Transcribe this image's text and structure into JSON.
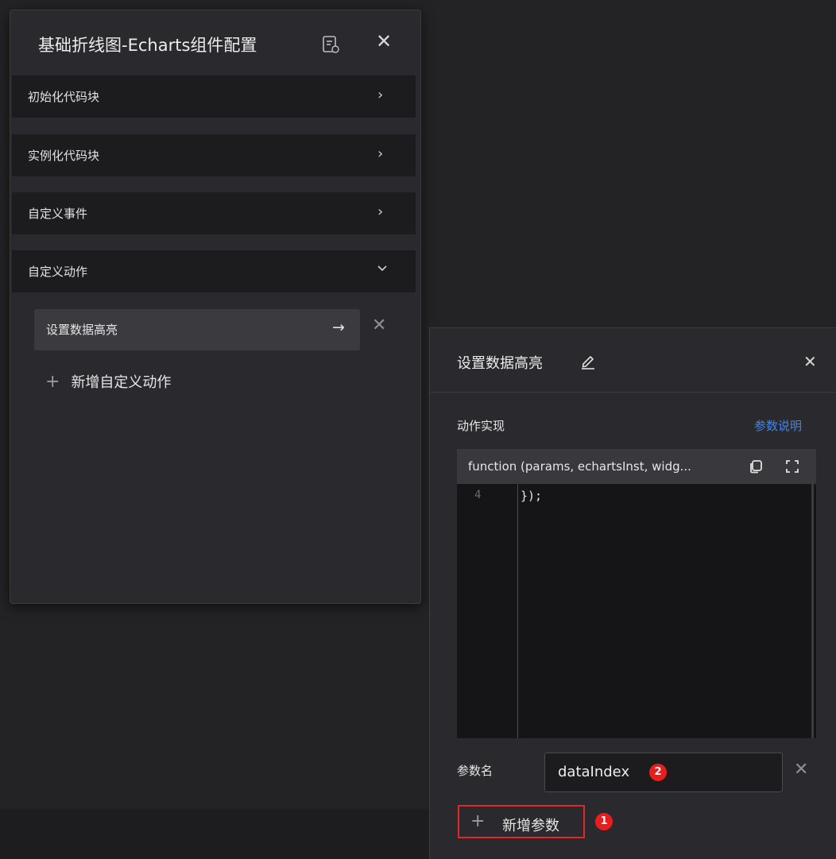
{
  "config_panel": {
    "title": "基础折线图-Echarts组件配置",
    "sections": [
      {
        "label": "初始化代码块",
        "expanded": false
      },
      {
        "label": "实例化代码块",
        "expanded": false
      },
      {
        "label": "自定义事件",
        "expanded": false
      },
      {
        "label": "自定义动作",
        "expanded": true
      }
    ],
    "actions": [
      {
        "label": "设置数据高亮"
      }
    ],
    "add_action_label": "新增自定义动作",
    "icons": {
      "doc": "doc-help-icon",
      "close": "close-icon",
      "arrow": "arrow-right-icon",
      "chevron_right": "chevron-right-icon",
      "chevron_down": "chevron-down-icon",
      "plus": "plus-icon"
    }
  },
  "action_panel": {
    "title": "设置数据高亮",
    "impl_label": "动作实现",
    "param_doc_link": "参数说明",
    "code": {
      "signature": "function (params, echartsInst, widg...",
      "lines": [
        {
          "no": "4",
          "text": "});"
        }
      ]
    },
    "param_label": "参数名",
    "param_value": "dataIndex",
    "add_param_label": "新增参数"
  },
  "annotations": {
    "badge_1": "1",
    "badge_2": "2",
    "highlight_color": "#e32626",
    "badge_color": "#e81e1e"
  },
  "colors": {
    "link": "#3b86f5",
    "panel_bg": "#2a2a2e",
    "section_bg": "#1c1c1f",
    "page_bg": "#232325"
  }
}
